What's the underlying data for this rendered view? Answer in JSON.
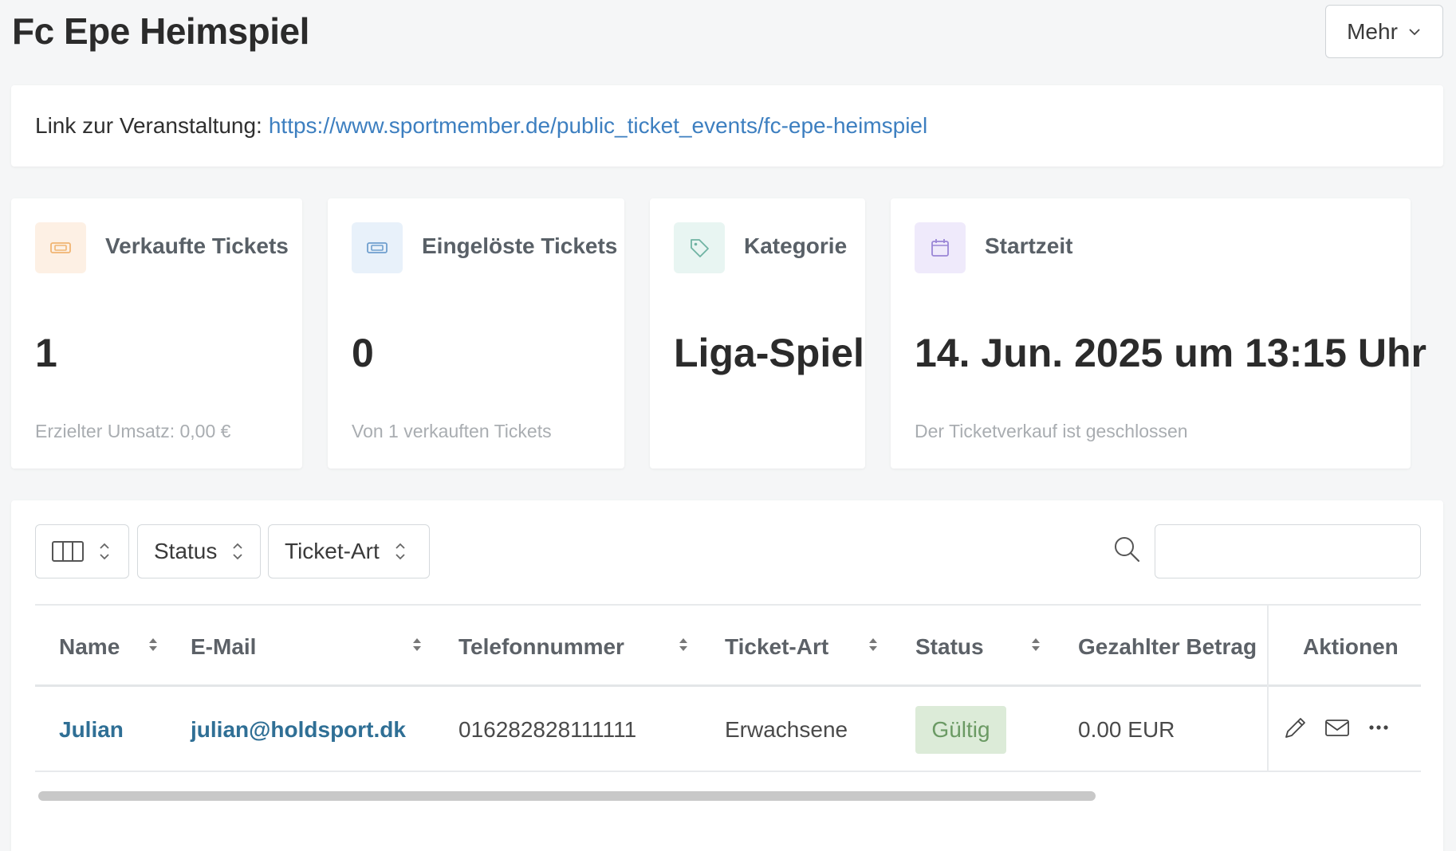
{
  "header": {
    "title": "Fc Epe Heimspiel",
    "more_label": "Mehr"
  },
  "event_link": {
    "label": "Link zur Veranstaltung:",
    "url": "https://www.sportmember.de/public_ticket_events/fc-epe-heimspiel"
  },
  "stats": [
    {
      "icon": "ticket-icon",
      "label": "Verkaufte Tickets",
      "value": "1",
      "sub": "Erzielter Umsatz: 0,00 €",
      "icon_bg": "#fdf0e4",
      "icon_color": "#f0b572"
    },
    {
      "icon": "ticket-icon",
      "label": "Eingelöste Tickets",
      "value": "0",
      "sub": "Von 1 verkauften Tickets",
      "icon_bg": "#e8f1fa",
      "icon_color": "#6f9fce"
    },
    {
      "icon": "tag-icon",
      "label": "Kategorie",
      "value": "Liga-Spiel",
      "sub": "",
      "icon_bg": "#e8f5f2",
      "icon_color": "#6fb3a3"
    },
    {
      "icon": "calendar-icon",
      "label": "Startzeit",
      "value": "14. Jun. 2025 um 13:15 Uhr",
      "sub": "Der Ticketverkauf ist geschlossen",
      "icon_bg": "#efeafb",
      "icon_color": "#9a86d6"
    }
  ],
  "filters": {
    "status_label": "Status",
    "ticket_type_label": "Ticket-Art",
    "search_placeholder": ""
  },
  "table": {
    "columns": [
      "Name",
      "E-Mail",
      "Telefonnummer",
      "Ticket-Art",
      "Status",
      "Gezahlter Betrag",
      "Aktionen"
    ],
    "rows": [
      {
        "name": "Julian",
        "email": "julian@holdsport.dk",
        "phone": "016282828111111",
        "ticket_type": "Erwachsene",
        "status": "Gültig",
        "amount": "0.00 EUR"
      }
    ]
  },
  "colors": {
    "link": "#3d7fc0",
    "badge_bg": "#dcebd8",
    "badge_text": "#6b9a64"
  }
}
